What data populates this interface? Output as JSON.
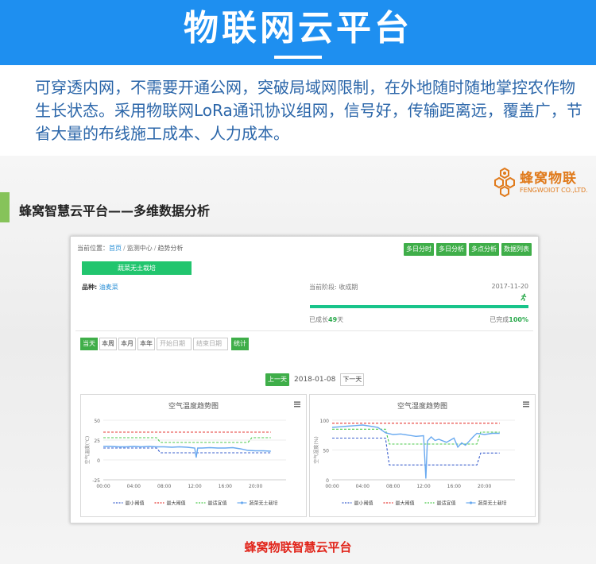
{
  "banner": {
    "title": "物联网云平台"
  },
  "intro": {
    "text": "可穿透内网，不需要开通公网，突破局域网限制，在外地随时随地掌控农作物生长状态。采用物联网LoRa通讯协议组网，信号好，传输距离远，覆盖广，节省大量的布线施工成本、人力成本。"
  },
  "section": {
    "title": "蜂窝智慧云平台——多维数据分析"
  },
  "logo": {
    "cn": "蜂窝物联",
    "en": "FENGWOIOT CO.,LTD."
  },
  "caption": "蜂窝物联智慧云平台",
  "colors": {
    "banner": "#1e8ff0",
    "accent_green": "#3fae49",
    "max": "#e53935",
    "min": "#3a5fcd",
    "optimal": "#4cc94c",
    "series": "#6aaaf0"
  },
  "panel": {
    "breadcrumb": {
      "prefix": "当前位置：",
      "home": "首页",
      "sep": "/",
      "monitor": "监测中心",
      "current": "趋势分析"
    },
    "top_buttons": [
      "多日分时",
      "多日分析",
      "多点分析",
      "数据列表"
    ],
    "crop_name": "蔬菜无土栽培",
    "variety_label": "品种:",
    "variety_value": "油麦菜",
    "stage_label": "当前阶段:",
    "stage_value": "收成期",
    "date": "2017-11-20",
    "grown_prefix": "已成长",
    "grown_days": "49",
    "grown_suffix": "天",
    "done_prefix": "已完成",
    "done_percent": "100%",
    "progress": 1.0,
    "filter": {
      "buttons": [
        "当天",
        "本周",
        "本月",
        "本年"
      ],
      "start_placeholder": "开始日期",
      "end_placeholder": "结束日期",
      "submit": "统计"
    },
    "day_nav": {
      "prev": "上一天",
      "current": "2018-01-08",
      "next": "下一天"
    }
  },
  "chart_data": [
    {
      "type": "line",
      "title": "空气温度趋势图",
      "ylabel": "空气温度(℃)",
      "x_ticks": [
        "00:00",
        "04:00",
        "08:00",
        "12:00",
        "16:00",
        "20:00"
      ],
      "ylim": [
        -25,
        50
      ],
      "y_ticks": [
        50,
        25,
        0,
        -25
      ],
      "series": [
        {
          "name": "最小阈值",
          "style": "dashed",
          "color": "#3a5fcd",
          "x": [
            0,
            7,
            7.5,
            22
          ],
          "y": [
            15,
            15,
            9,
            9
          ]
        },
        {
          "name": "最大阈值",
          "style": "dashed",
          "color": "#e53935",
          "x": [
            0,
            22
          ],
          "y": [
            35,
            35
          ]
        },
        {
          "name": "最适宜值",
          "style": "dashed",
          "color": "#4cc94c",
          "x": [
            0,
            7,
            7.5,
            19,
            19.5,
            22
          ],
          "y": [
            28,
            28,
            22,
            22,
            28,
            28
          ]
        },
        {
          "name": "蔬菜无土栽培",
          "style": "solid",
          "color": "#6aaaf0",
          "x": [
            0,
            1,
            2,
            3,
            4,
            5,
            6,
            7,
            8,
            9,
            10,
            11,
            12,
            12.2,
            12.4,
            13,
            14,
            15,
            16,
            17,
            18,
            19,
            20,
            21,
            22
          ],
          "y": [
            17,
            17,
            16.5,
            16.5,
            17,
            16.5,
            17,
            16.5,
            16.5,
            16,
            16.5,
            16,
            15,
            3,
            15,
            15,
            15.5,
            15,
            15,
            15.5,
            14,
            12,
            11.5,
            11.5,
            11
          ]
        }
      ]
    },
    {
      "type": "line",
      "title": "空气湿度趋势图",
      "ylabel": "空气湿度(%)",
      "x_ticks": [
        "00:00",
        "04:00",
        "08:00",
        "12:00",
        "16:00",
        "20:00"
      ],
      "ylim": [
        0,
        100
      ],
      "y_ticks": [
        100,
        50,
        0
      ],
      "series": [
        {
          "name": "最小阈值",
          "style": "dashed",
          "color": "#3a5fcd",
          "x": [
            0,
            7,
            7.5,
            19,
            19.5,
            22
          ],
          "y": [
            70,
            70,
            25,
            25,
            45,
            45
          ]
        },
        {
          "name": "最大阈值",
          "style": "dashed",
          "color": "#e53935",
          "x": [
            0,
            22
          ],
          "y": [
            95,
            95
          ]
        },
        {
          "name": "最适宜值",
          "style": "dashed",
          "color": "#4cc94c",
          "x": [
            0,
            7,
            7.5,
            19,
            19.5,
            22
          ],
          "y": [
            85,
            85,
            60,
            60,
            80,
            80
          ]
        },
        {
          "name": "蔬菜无土栽培",
          "style": "solid",
          "color": "#6aaaf0",
          "x": [
            0,
            1,
            2,
            3,
            4,
            5,
            6,
            7,
            8,
            9,
            10,
            11,
            12,
            12.3,
            12.5,
            13,
            13.5,
            14,
            15,
            16,
            16.5,
            17,
            17.5,
            18,
            18.5,
            19,
            20,
            21,
            22
          ],
          "y": [
            88,
            89,
            90,
            91,
            92,
            90,
            88,
            79,
            76,
            77,
            75,
            73,
            74,
            2,
            65,
            72,
            66,
            68,
            63,
            70,
            55,
            62,
            58,
            65,
            72,
            78,
            76,
            78,
            78
          ]
        }
      ]
    }
  ]
}
